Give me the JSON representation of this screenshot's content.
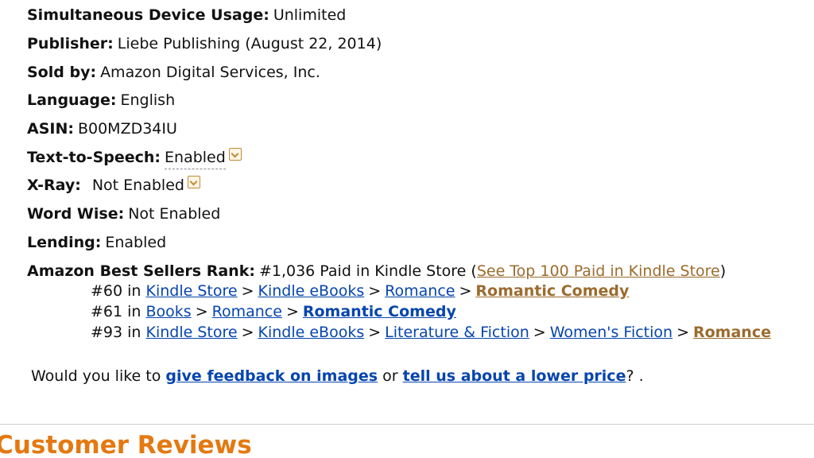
{
  "details": {
    "simultaneous_usage": {
      "label": "Simultaneous Device Usage:",
      "value": "Unlimited"
    },
    "publisher": {
      "label": "Publisher:",
      "value": "Liebe Publishing (August 22, 2014)"
    },
    "sold_by": {
      "label": "Sold by:",
      "value": "Amazon Digital Services, Inc."
    },
    "language": {
      "label": "Language:",
      "value": "English"
    },
    "asin": {
      "label": "ASIN:",
      "value": "B00MZD34IU"
    },
    "tts": {
      "label": "Text-to-Speech:",
      "value": "Enabled",
      "icon": "chevron-down-icon"
    },
    "xray": {
      "label": "X-Ray:",
      "value": "Not Enabled",
      "icon": "chevron-down-icon"
    },
    "word_wise": {
      "label": "Word Wise:",
      "value": "Not Enabled"
    },
    "lending": {
      "label": "Lending:",
      "value": "Enabled"
    }
  },
  "rank": {
    "label": "Amazon Best Sellers Rank:",
    "main_text": "#1,036 Paid in Kindle Store (",
    "main_link": "See Top 100 Paid in Kindle Store",
    "main_close": ")",
    "sep": ">",
    "lines": [
      {
        "prefix": "#60 in",
        "crumbs": [
          "Kindle Store",
          "Kindle eBooks",
          "Romance"
        ],
        "final": "Romantic Comedy"
      },
      {
        "prefix": "#61 in",
        "crumbs": [
          "Books",
          "Romance"
        ],
        "final": "Romantic Comedy"
      },
      {
        "prefix": "#93 in",
        "crumbs": [
          "Kindle Store",
          "Kindle eBooks",
          "Literature & Fiction",
          "Women's Fiction"
        ],
        "final": "Romance"
      }
    ]
  },
  "feedback": {
    "prefix": "Would you like to",
    "link1": "give feedback on images",
    "middle": "or",
    "link2": "tell us about a lower price",
    "suffix": "? ."
  },
  "reviews": {
    "title": "Customer Reviews"
  },
  "colors": {
    "link_blue": "#0645ad",
    "link_brown": "#9c6b2e",
    "reviews_orange": "#e47911"
  }
}
